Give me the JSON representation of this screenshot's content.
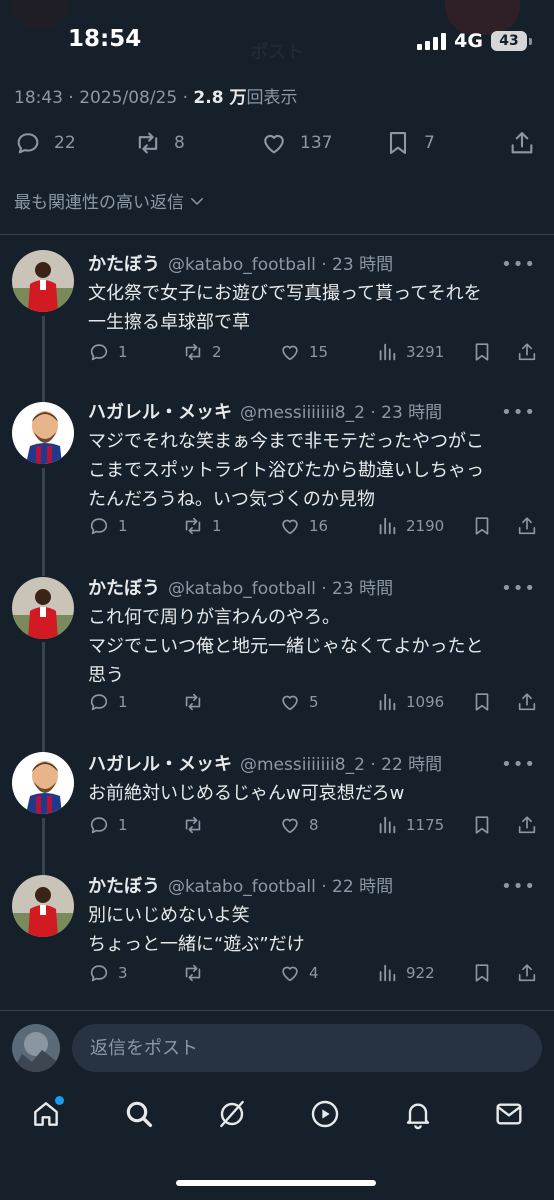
{
  "status_bar": {
    "time": "18:54",
    "network": "4G",
    "battery": "43"
  },
  "ghost_header": "ポスト",
  "post_meta": {
    "time": "18:43 · 2025/08/25 · ",
    "views_count": "2.8 万",
    "views_label": "回表示"
  },
  "post_actions": {
    "replies": "22",
    "reposts": "8",
    "likes": "137",
    "bookmarks": "7"
  },
  "sort_label": "最も関連性の高い返信",
  "replies": [
    {
      "name": "かたぼう",
      "handle": "@katabo_football · 23 時間",
      "lines": [
        "文化祭で女子にお遊びで写真撮って貰ってそれを",
        "一生擦る卓球部で草"
      ],
      "replies": "1",
      "reposts": "2",
      "likes": "15",
      "views": "3291"
    },
    {
      "name": "ハガレル・メッキ",
      "handle": "@messiiiiiii8_2 · 23 時間",
      "lines": [
        "マジでそれな笑まぁ今まで非モテだったやつがこ",
        "こまでスポットライト浴びたから勘違いしちゃっ",
        "たんだろうね。いつ気づくのか見物"
      ],
      "replies": "1",
      "reposts": "1",
      "likes": "16",
      "views": "2190"
    },
    {
      "name": "かたぼう",
      "handle": "@katabo_football · 23 時間",
      "lines": [
        "これ何で周りが言わんのやろ。",
        "マジでこいつ俺と地元一緒じゃなくてよかったと",
        "思う"
      ],
      "replies": "1",
      "reposts": "",
      "likes": "5",
      "views": "1096"
    },
    {
      "name": "ハガレル・メッキ",
      "handle": "@messiiiiiii8_2 · 22 時間",
      "lines": [
        "お前絶対いじめるじゃんw可哀想だろw"
      ],
      "replies": "1",
      "reposts": "",
      "likes": "8",
      "views": "1175"
    },
    {
      "name": "かたぼう",
      "handle": "@katabo_football · 22 時間",
      "lines": [
        "別にいじめないよ笑",
        "ちょっと一緒に“遊ぶ”だけ"
      ],
      "replies": "3",
      "reposts": "",
      "likes": "4",
      "views": "922"
    }
  ],
  "reply_box": {
    "placeholder": "返信をポスト"
  },
  "tabs": [
    "home-icon",
    "search-icon",
    "grok-icon",
    "play-icon",
    "bell-icon",
    "mail-icon"
  ],
  "colors": {
    "background": "#15202b",
    "secondary_text": "#8b98a5",
    "accent": "#1d9bf0"
  }
}
